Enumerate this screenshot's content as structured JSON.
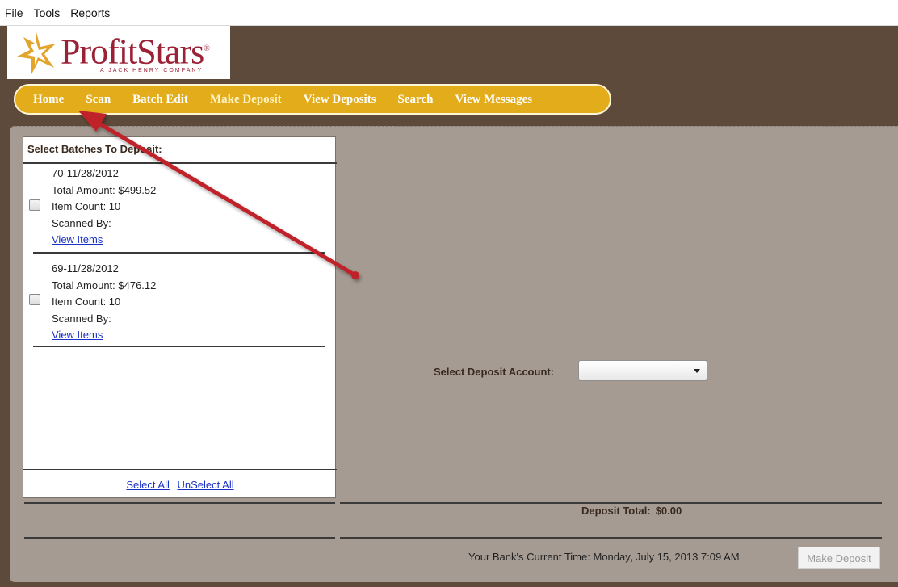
{
  "menubar": {
    "items": [
      "File",
      "Tools",
      "Reports"
    ]
  },
  "logo": {
    "name": "ProfitStars",
    "registered_mark": "®",
    "tagline": "A JACK HENRY COMPANY",
    "colors": {
      "text": "#9b2136",
      "star": "#e3a42c"
    }
  },
  "nav": {
    "items": [
      "Home",
      "Scan",
      "Batch Edit",
      "Make Deposit",
      "View Deposits",
      "Search",
      "View Messages"
    ],
    "active": "Make Deposit",
    "color": "#e3ac1a"
  },
  "batches": {
    "header": "Select Batches To Deposit:",
    "items": [
      {
        "id": "70-11/28/2012",
        "total": "Total Amount: $499.52",
        "count": "Item Count: 10",
        "scanned_by": "Scanned By:",
        "link": "View Items",
        "checked": false
      },
      {
        "id": "69-11/28/2012",
        "total": "Total Amount: $476.12",
        "count": "Item Count: 10",
        "scanned_by": "Scanned By:",
        "link": "View Items",
        "checked": false
      }
    ],
    "select_all": "Select All",
    "unselect_all": "UnSelect All"
  },
  "deposit": {
    "account_label": "Select Deposit Account:",
    "account_value": "",
    "total_label": "Deposit Total:",
    "total_value": "$0.00"
  },
  "footer": {
    "bank_time": "Your Bank's Current Time: Monday, July 15, 2013 7:09 AM",
    "make_deposit_label": "Make Deposit",
    "make_deposit_enabled": false
  },
  "annotation": {
    "arrow_color": "#c0202a",
    "points_to": "Home"
  }
}
